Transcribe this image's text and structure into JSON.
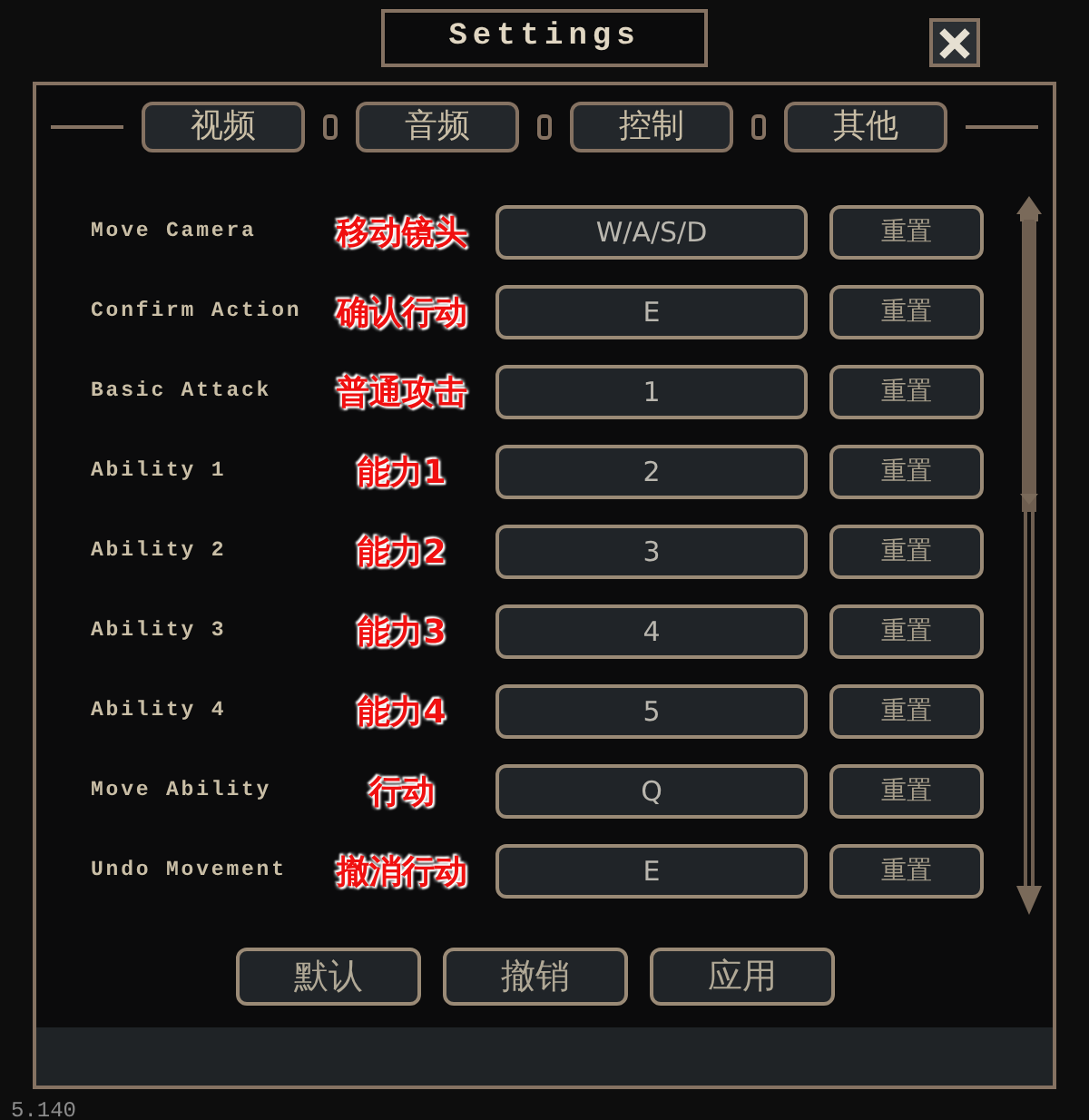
{
  "window": {
    "title": "Settings"
  },
  "tabs": [
    {
      "label": "视频"
    },
    {
      "label": "音频"
    },
    {
      "label": "控制"
    },
    {
      "label": "其他"
    }
  ],
  "bindings": [
    {
      "label": "Move Camera",
      "annotation": "移动镜头",
      "key": "W/A/S/D",
      "reset": "重置"
    },
    {
      "label": "Confirm Action",
      "annotation": "确认行动",
      "key": "E",
      "reset": "重置"
    },
    {
      "label": "Basic Attack",
      "annotation": "普通攻击",
      "key": "1",
      "reset": "重置"
    },
    {
      "label": "Ability 1",
      "annotation": "能力1",
      "key": "2",
      "reset": "重置"
    },
    {
      "label": "Ability 2",
      "annotation": "能力2",
      "key": "3",
      "reset": "重置"
    },
    {
      "label": "Ability 3",
      "annotation": "能力3",
      "key": "4",
      "reset": "重置"
    },
    {
      "label": "Ability 4",
      "annotation": "能力4",
      "key": "5",
      "reset": "重置"
    },
    {
      "label": "Move Ability",
      "annotation": "行动",
      "key": "Q",
      "reset": "重置"
    },
    {
      "label": "Undo Movement",
      "annotation": "撤消行动",
      "key": "E",
      "reset": "重置"
    }
  ],
  "buttons": [
    "默认",
    "撤销",
    "应用"
  ],
  "version": "5.140"
}
